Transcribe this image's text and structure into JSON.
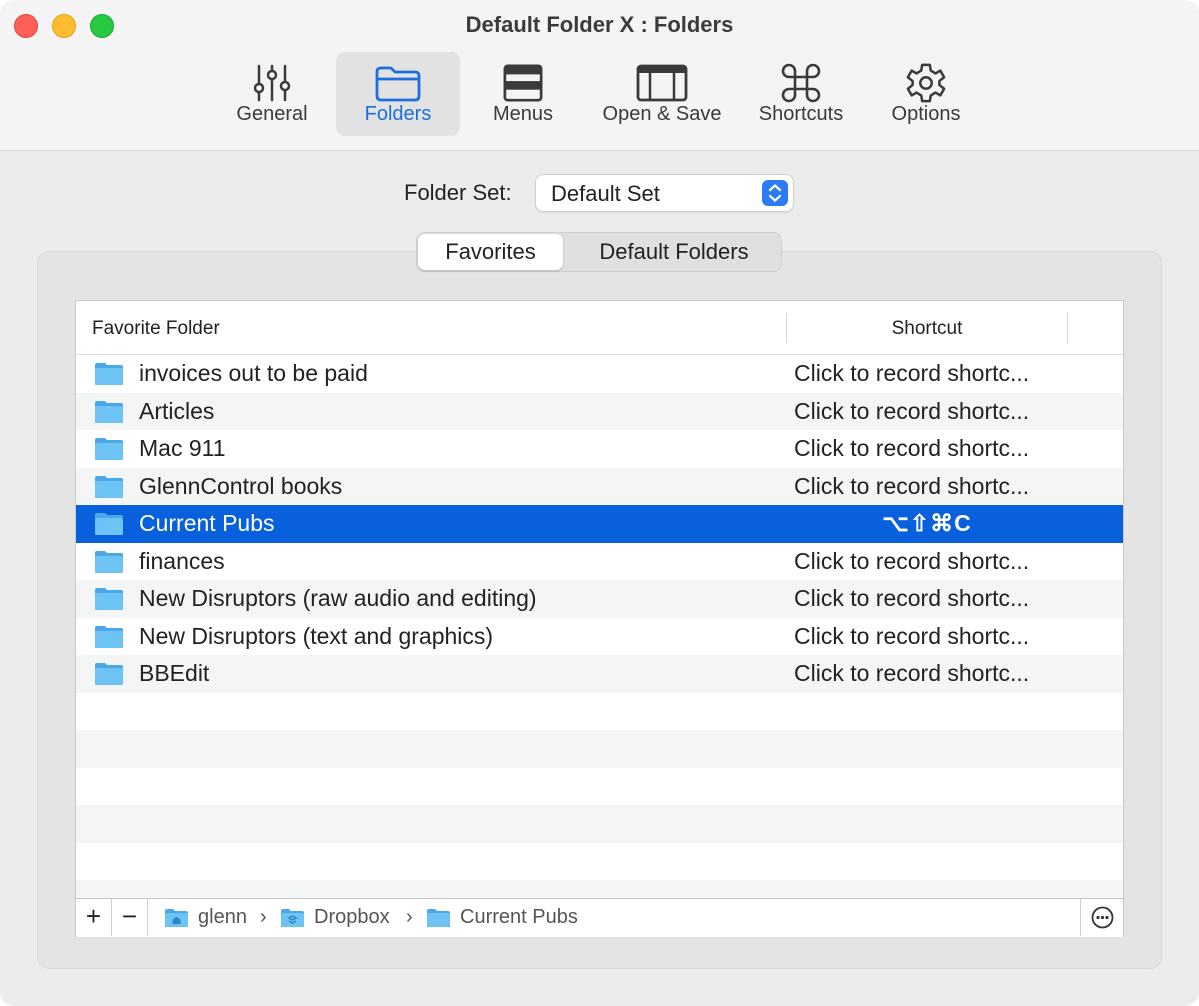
{
  "window": {
    "title": "Default Folder X : Folders"
  },
  "toolbar": {
    "items": [
      {
        "label": "General",
        "icon": "sliders-icon",
        "selected": false
      },
      {
        "label": "Folders",
        "icon": "folder-icon",
        "selected": true
      },
      {
        "label": "Menus",
        "icon": "menu-icon",
        "selected": false
      },
      {
        "label": "Open & Save",
        "icon": "window-icon",
        "selected": false
      },
      {
        "label": "Shortcuts",
        "icon": "command-icon",
        "selected": false
      },
      {
        "label": "Options",
        "icon": "gear-icon",
        "selected": false
      }
    ]
  },
  "folder_set": {
    "label": "Folder Set:",
    "value": "Default Set"
  },
  "segmented": {
    "favorites": "Favorites",
    "default_folders": "Default Folders",
    "selected": "Favorites"
  },
  "table": {
    "columns": {
      "favorite_folder": "Favorite Folder",
      "shortcut": "Shortcut"
    },
    "rows": [
      {
        "name": "invoices out to be paid",
        "shortcut": "Click to record shortc...",
        "selected": false
      },
      {
        "name": "Articles",
        "shortcut": "Click to record shortc...",
        "selected": false
      },
      {
        "name": "Mac 911",
        "shortcut": "Click to record shortc...",
        "selected": false
      },
      {
        "name": "GlennControl books",
        "shortcut": "Click to record shortc...",
        "selected": false
      },
      {
        "name": "Current Pubs",
        "shortcut": "⌥⇧⌘C",
        "selected": true
      },
      {
        "name": "finances",
        "shortcut": "Click to record shortc...",
        "selected": false
      },
      {
        "name": "New Disruptors (raw audio and editing)",
        "shortcut": "Click to record shortc...",
        "selected": false
      },
      {
        "name": "New Disruptors (text and graphics)",
        "shortcut": "Click to record shortc...",
        "selected": false
      },
      {
        "name": "BBEdit",
        "shortcut": "Click to record shortc...",
        "selected": false
      }
    ]
  },
  "footer": {
    "add_label": "+",
    "remove_label": "−",
    "path": [
      {
        "label": "glenn",
        "icon": "home-folder-icon"
      },
      {
        "label": "Dropbox",
        "icon": "dropbox-folder-icon"
      },
      {
        "label": "Current Pubs",
        "icon": "folder-icon"
      }
    ],
    "path_separator": "›"
  },
  "colors": {
    "accent": "#0860dc",
    "folder_blue": "#5ab8f0",
    "selected_tab_text": "#1b6fde"
  }
}
